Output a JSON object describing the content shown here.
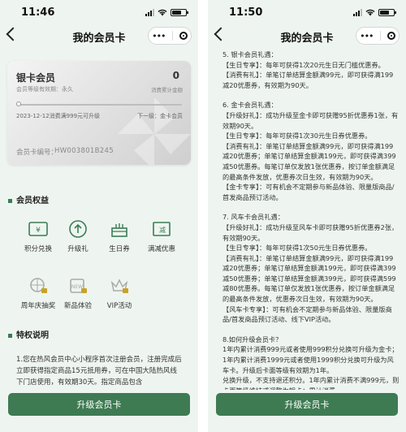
{
  "left": {
    "status_time": "11:46",
    "title": "我的会员卡",
    "dots": "•••",
    "card": {
      "name": "银卡会员",
      "validity": "会员等级有效期：永久",
      "points": "0",
      "points_label": "消费累计金额",
      "progress": 0,
      "upgrade_tip": "2023-12-12消费满999元可升级",
      "next_level": "下一级：金卡会员",
      "number_label": "会员卡编号：",
      "number": "HW003801B245"
    },
    "benefits_title": "会员权益",
    "benefits": [
      {
        "label": "积分兑换",
        "icon": "yen-ticket-icon"
      },
      {
        "label": "升级礼",
        "icon": "arrow-up-circle-icon"
      },
      {
        "label": "生日券",
        "icon": "cake-icon"
      },
      {
        "label": "满减优惠",
        "icon": "discount-ticket-icon"
      },
      {
        "label": "周年庆抽奖",
        "icon": "lottery-icon"
      },
      {
        "label": "新品体验",
        "icon": "new-product-icon"
      },
      {
        "label": "VIP活动",
        "icon": "vip-icon"
      }
    ],
    "privileges_title": "特权说明",
    "privileges_text": "1.您在热风会员中心小程序首次注册会员，注册完成后立即获得指定商品15元抵用券，可在中国大陆热风线下门店使用，有效期30天。指定商品包含",
    "button_label": "升级会员卡"
  },
  "right": {
    "status_time": "11:50",
    "title": "我的会员卡",
    "dots": "•••",
    "rules": [
      "5. 银卡会员礼遇：",
      "【生日专享】：每年可获得1次20元生日无门槛优惠券。",
      "【消费有礼】：单笔订单结算金额满99元，即可获得满199减20优惠券，有效期为90天。",
      "",
      "6. 金卡会员礼遇：",
      "【升级好礼】：成功升级至金卡即可获赠95折优惠券1张，有效期90天。",
      "【生日专享】：每年可获得1次30元生日券优惠券。",
      "【消费有礼】：单笔订单结算金额满99元，即可获得满199减20优惠券；单笔订单结算金额满199元，即可获得满399减50优惠券。每笔订单仅发放1张优惠券，按订单金额满足的最高条件发放，优惠券次日生效，有效期为90天。",
      "【金卡专享】：可有机会不定期参与新品体验、限量版商品/首发商品预订活动。",
      "",
      "7. 风车卡会员礼遇：",
      "【升级好礼】：成功升级至风车卡即可获赠95折优惠券2张，有效期90天。",
      "【生日专享】：每年可获得1次50元生日券优惠券。",
      "【消费有礼】：单笔订单结算金额满99元，即可获得满199减20优惠券；单笔订单结算金额满199元，即可获得满399减50优惠券；单笔订单结算金额满399元，即可获得满599减80优惠券。每笔订单仅发放1张优惠券，按订单金额满足的最高条件发放，优惠券次日生效，有效期为90天。",
      "【风车卡专享】：可有机会不定期参与新品体验、限量版商品/首发商品预订活动、线下VIP活动。",
      "",
      "8.如何升级会员卡？",
      "1年内累计消费999元或者使用999积分兑换可升级为金卡；1年内累计消费1999元或者使用1999积分兑换可升级为风车卡。升级后卡面等级有效期为1年。",
      "兑换升级，不支持退还积分。1年内累计消费不满999元，则卡面等级维持或调整为银卡；累计消费"
    ],
    "button_label": "升级会员卡"
  }
}
